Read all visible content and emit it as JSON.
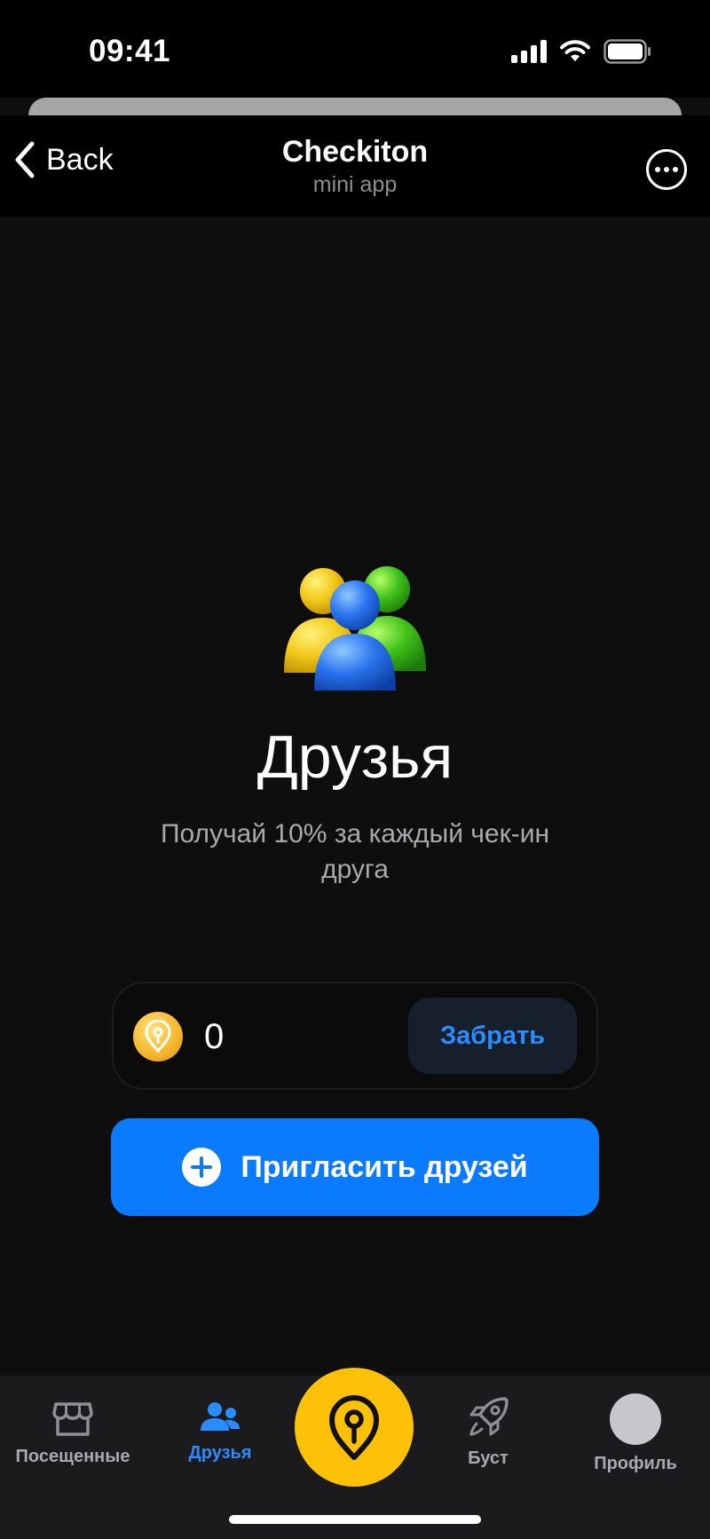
{
  "status_bar": {
    "time": "09:41"
  },
  "nav": {
    "back_label": "Back",
    "title": "Checkiton",
    "subtitle": "mini app"
  },
  "main": {
    "title": "Друзья",
    "description": "Получай 10% за каждый чек-ин друга",
    "balance_value": "0",
    "claim_label": "Забрать",
    "invite_label": "Пригласить друзей"
  },
  "tabbar": {
    "items": [
      {
        "label": "Посещенные",
        "icon": "store-icon",
        "active": false
      },
      {
        "label": "Друзья",
        "icon": "friends-icon",
        "active": true
      },
      {
        "label": "",
        "icon": "location-pin-icon",
        "active": false
      },
      {
        "label": "Буст",
        "icon": "rocket-icon",
        "active": false
      },
      {
        "label": "Профиль",
        "icon": "avatar",
        "active": false
      }
    ]
  },
  "colors": {
    "accent": "#0a7aff",
    "accent_text": "#2b8cff",
    "center_button": "#ffc107",
    "background": "#0e0e0e"
  }
}
